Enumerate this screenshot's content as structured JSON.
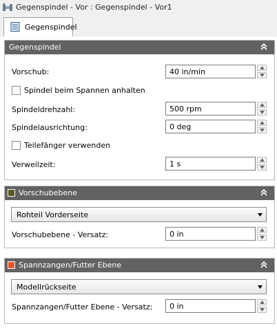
{
  "window": {
    "title": "Gegenspindel - Vor : Gegenspindel - Vor1"
  },
  "tab": {
    "label": "Gegenspindel"
  },
  "panels": {
    "gegenspindel": {
      "title": "Gegenspindel",
      "vorschub": {
        "label": "Vorschub:",
        "value": "40 in/min"
      },
      "spindel_anhalten": {
        "label": "Spindel beim Spannen anhalten",
        "checked": false
      },
      "drehzahl": {
        "label": "Spindeldrehzahl:",
        "value": "500 rpm"
      },
      "ausrichtung": {
        "label": "Spindelausrichtung:",
        "value": "0 deg"
      },
      "teilefaenger": {
        "label": "Teilefänger verwenden",
        "checked": false
      },
      "verweilzeit": {
        "label": "Verweilzeit:",
        "value": "1 s"
      }
    },
    "vorschubebene": {
      "title": "Vorschubebene",
      "swatch_color": "#5a5a1e",
      "dropdown": {
        "selected": "Rohteil Vorderseite"
      },
      "versatz": {
        "label": "Vorschubebene - Versatz:",
        "value": "0 in"
      }
    },
    "spannzangen": {
      "title": "Spannzangen/Futter Ebene",
      "swatch_color": "#e8542a",
      "dropdown": {
        "selected": "Modellrückseite"
      },
      "versatz": {
        "label": "Spannzangen/Futter Ebene - Versatz:",
        "value": "0 in"
      }
    }
  },
  "icons": {
    "window": "spindle-operation-icon",
    "tab": "document-list-icon",
    "collapse": "double-chevron-up-icon"
  }
}
